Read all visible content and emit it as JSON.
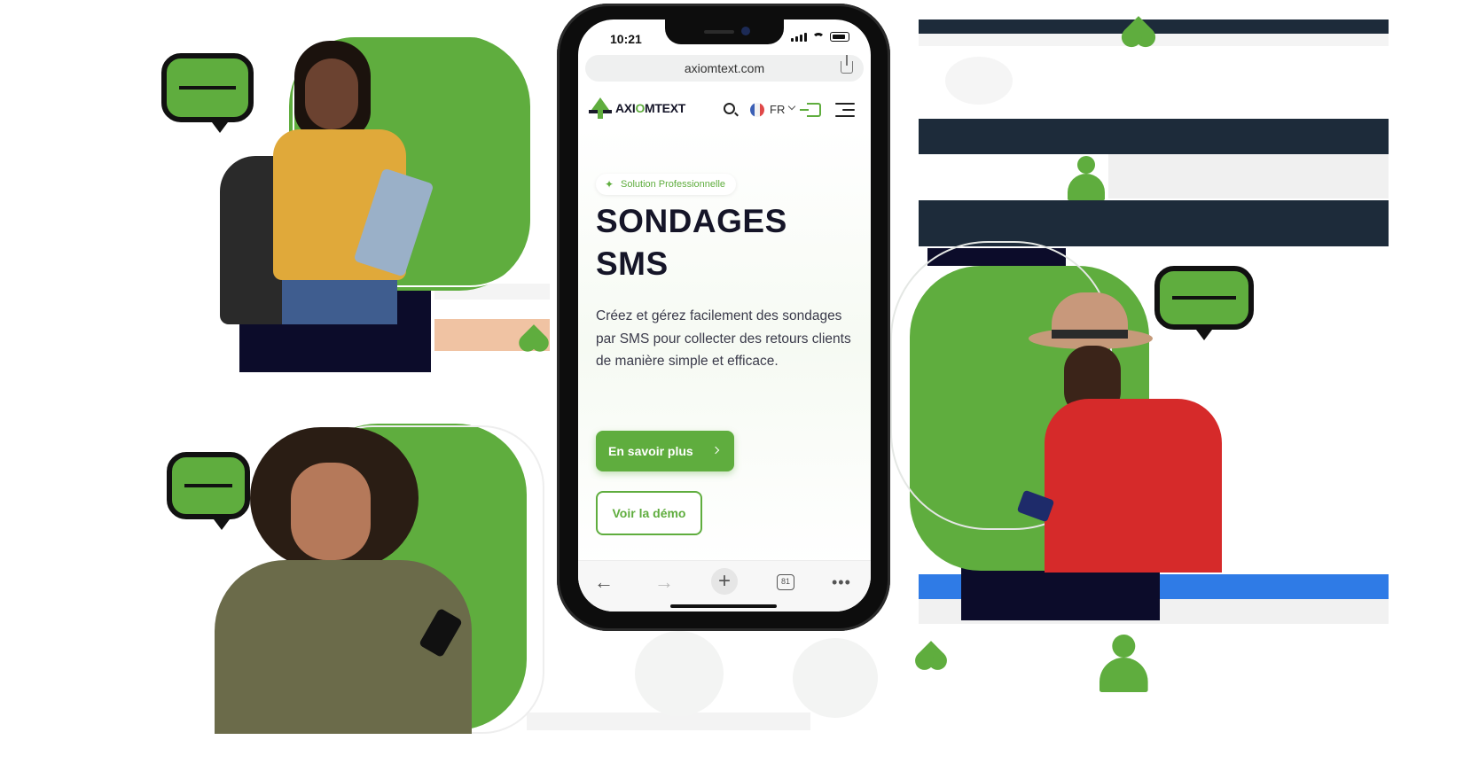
{
  "status": {
    "time": "10:21"
  },
  "browser": {
    "url": "axiomtext.com",
    "tabs_count": "81"
  },
  "nav": {
    "logo_pre": "AXI",
    "logo_o": "O",
    "logo_post": "MTEXT",
    "lang": "FR"
  },
  "hero": {
    "tag": "Solution Professionnelle",
    "title_line1": "SONDAGES",
    "title_line2": "SMS",
    "description": "Créez et gérez facilement des sondages par SMS pour collecter des retours clients de manière simple et efficace.",
    "cta_primary": "En savoir plus",
    "cta_secondary": "Voir la démo"
  },
  "colors": {
    "brand_green": "#5fad3e",
    "dark_navy": "#151528"
  },
  "icons": [
    "search-icon",
    "flag-fr-icon",
    "chevron-down-icon",
    "login-icon",
    "menu-icon",
    "share-icon",
    "sparkle-icon",
    "chevron-right-icon",
    "back-arrow-icon",
    "forward-arrow-icon",
    "plus-icon",
    "tabs-icon",
    "more-icon",
    "chat-bubble-icon",
    "heart-icon",
    "user-icon",
    "smiley-icon"
  ]
}
